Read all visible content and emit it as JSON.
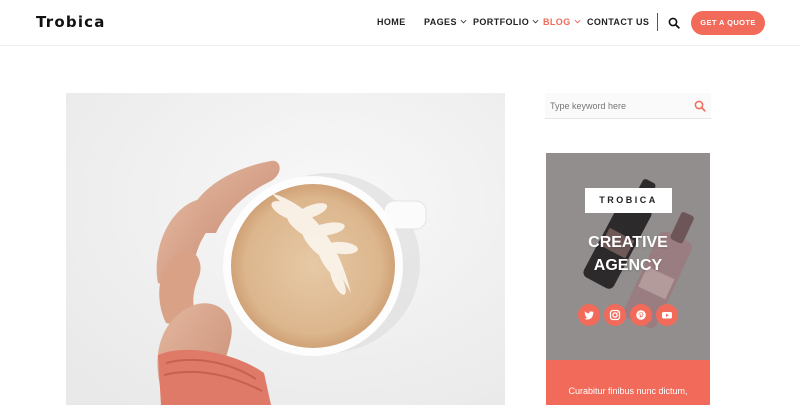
{
  "header": {
    "logo": "Trobica",
    "nav": [
      {
        "label": "HOME",
        "has_dropdown": false,
        "active": false
      },
      {
        "label": "PAGES",
        "has_dropdown": true,
        "active": false
      },
      {
        "label": "PORTFOLIO",
        "has_dropdown": true,
        "active": false
      },
      {
        "label": "BLOG",
        "has_dropdown": true,
        "active": true
      },
      {
        "label": "CONTACT US",
        "has_dropdown": false,
        "active": false
      }
    ],
    "search_icon": "search-icon",
    "cta_label": "GET A QUOTE"
  },
  "sidebar": {
    "search": {
      "placeholder": "Type keyword here",
      "icon": "search-icon"
    },
    "banner": {
      "brand": "TROBICA",
      "title_line1": "CREATIVE",
      "title_line2": "AGENCY",
      "social": [
        "twitter-icon",
        "instagram-icon",
        "pinterest-icon",
        "youtube-icon"
      ],
      "text": "Curabitur finibus nunc dictum,"
    }
  },
  "colors": {
    "accent": "#f26a5a",
    "banner_bg": "#928e8e",
    "text_dark": "#222222"
  }
}
